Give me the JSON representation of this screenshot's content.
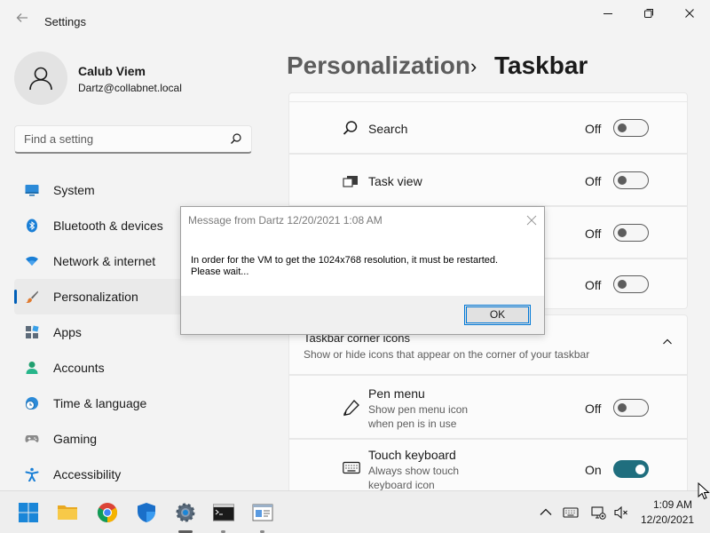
{
  "app": {
    "title": "Settings"
  },
  "user": {
    "name": "Calub Viem",
    "email": "Dartz@collabnet.local"
  },
  "search": {
    "placeholder": "Find a setting"
  },
  "sidebar": {
    "items": [
      {
        "label": "System",
        "icon": "system-icon"
      },
      {
        "label": "Bluetooth & devices",
        "icon": "bluetooth-icon"
      },
      {
        "label": "Network & internet",
        "icon": "wifi-icon"
      },
      {
        "label": "Personalization",
        "icon": "brush-icon",
        "active": true
      },
      {
        "label": "Apps",
        "icon": "apps-icon"
      },
      {
        "label": "Accounts",
        "icon": "accounts-icon"
      },
      {
        "label": "Time & language",
        "icon": "clock-globe-icon"
      },
      {
        "label": "Gaming",
        "icon": "gamepad-icon"
      },
      {
        "label": "Accessibility",
        "icon": "accessibility-icon"
      }
    ]
  },
  "breadcrumb": {
    "parent": "Personalization",
    "separator": "›",
    "current": "Taskbar"
  },
  "taskbar_items": {
    "search": {
      "label": "Search",
      "state": "Off"
    },
    "task_view": {
      "label": "Task view",
      "state": "Off"
    },
    "row3": {
      "state": "Off"
    },
    "row4": {
      "state": "Off"
    }
  },
  "corner_icons": {
    "title": "Taskbar corner icons",
    "subtitle": "Show or hide icons that appear on the corner of your taskbar",
    "pen_menu": {
      "label": "Pen menu",
      "sub1": "Show pen menu icon",
      "sub2": "when pen is in use",
      "state": "Off"
    },
    "touch_keyboard": {
      "label": "Touch keyboard",
      "sub1": "Always show touch",
      "sub2": "keyboard icon",
      "state": "On"
    }
  },
  "dialog": {
    "title": "Message from Dartz 12/20/2021 1:08 AM",
    "line1": "In order for the VM to get the 1024x768 resolution, it must be restarted.",
    "line2": "Please wait...",
    "ok_label": "OK"
  },
  "clock": {
    "time": "1:09 AM",
    "date": "12/20/2021"
  },
  "colors": {
    "accent": "#005fb8",
    "toggle_on": "#1f6e7e"
  }
}
